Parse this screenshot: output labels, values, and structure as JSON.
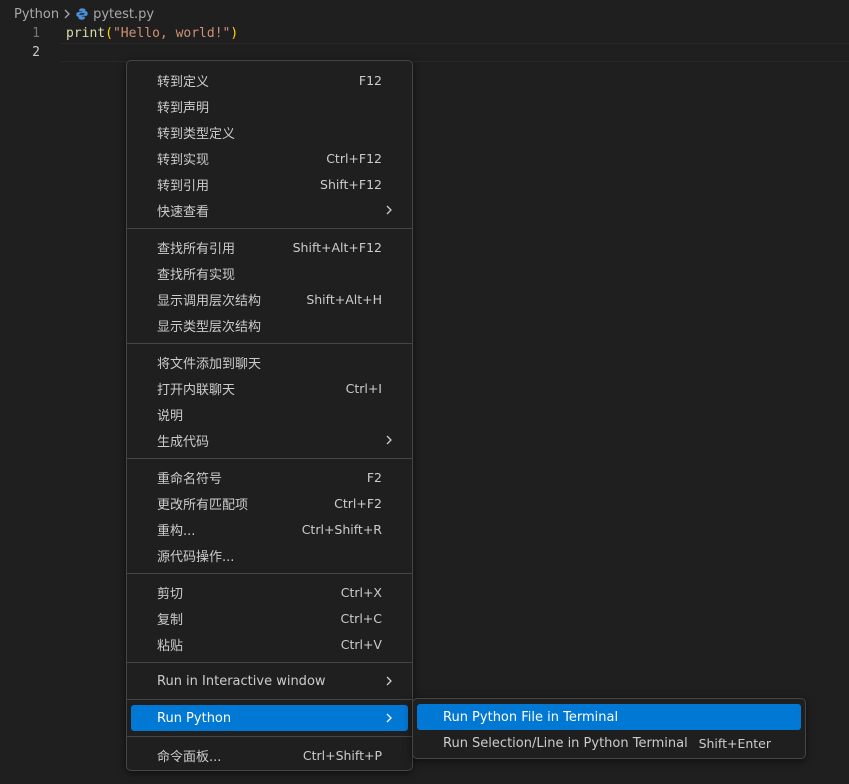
{
  "breadcrumb": {
    "folder": "Python",
    "file": "pytest.py"
  },
  "editor": {
    "lines": [
      {
        "number": "1",
        "code": {
          "fn": "print",
          "open": "(",
          "str": "\"Hello, world!\"",
          "close": ")"
        }
      },
      {
        "number": "2"
      }
    ]
  },
  "context_menu": {
    "groups": [
      {
        "items": [
          {
            "label": "转到定义",
            "shortcut": "F12"
          },
          {
            "label": "转到声明",
            "shortcut": ""
          },
          {
            "label": "转到类型定义",
            "shortcut": ""
          },
          {
            "label": "转到实现",
            "shortcut": "Ctrl+F12"
          },
          {
            "label": "转到引用",
            "shortcut": "Shift+F12"
          },
          {
            "label": "快速查看",
            "shortcut": "",
            "submenu": true
          }
        ]
      },
      {
        "items": [
          {
            "label": "查找所有引用",
            "shortcut": "Shift+Alt+F12"
          },
          {
            "label": "查找所有实现",
            "shortcut": ""
          },
          {
            "label": "显示调用层次结构",
            "shortcut": "Shift+Alt+H"
          },
          {
            "label": "显示类型层次结构",
            "shortcut": ""
          }
        ]
      },
      {
        "items": [
          {
            "label": "将文件添加到聊天",
            "shortcut": ""
          },
          {
            "label": "打开内联聊天",
            "shortcut": "Ctrl+I"
          },
          {
            "label": "说明",
            "shortcut": ""
          },
          {
            "label": "生成代码",
            "shortcut": "",
            "submenu": true
          }
        ]
      },
      {
        "items": [
          {
            "label": "重命名符号",
            "shortcut": "F2"
          },
          {
            "label": "更改所有匹配项",
            "shortcut": "Ctrl+F2"
          },
          {
            "label": "重构...",
            "shortcut": "Ctrl+Shift+R"
          },
          {
            "label": "源代码操作...",
            "shortcut": ""
          }
        ]
      },
      {
        "items": [
          {
            "label": "剪切",
            "shortcut": "Ctrl+X"
          },
          {
            "label": "复制",
            "shortcut": "Ctrl+C"
          },
          {
            "label": "粘贴",
            "shortcut": "Ctrl+V"
          }
        ]
      },
      {
        "items": [
          {
            "label": "Run in Interactive window",
            "shortcut": "",
            "submenu": true
          }
        ]
      },
      {
        "items": [
          {
            "label": "Run Python",
            "shortcut": "",
            "submenu": true,
            "highlighted": true
          }
        ]
      },
      {
        "items": [
          {
            "label": "命令面板...",
            "shortcut": "Ctrl+Shift+P"
          }
        ]
      }
    ]
  },
  "submenu": {
    "items": [
      {
        "label": "Run Python File in Terminal",
        "shortcut": "",
        "highlighted": true
      },
      {
        "label": "Run Selection/Line in Python Terminal",
        "shortcut": "Shift+Enter"
      }
    ]
  },
  "colors": {
    "accent": "#0078d4",
    "background": "#1f1f1f",
    "menu_border": "#454545"
  },
  "icons": {
    "file": "python-file-icon",
    "chevron": "chevron-right-icon",
    "separator": "chevron-right-icon"
  }
}
